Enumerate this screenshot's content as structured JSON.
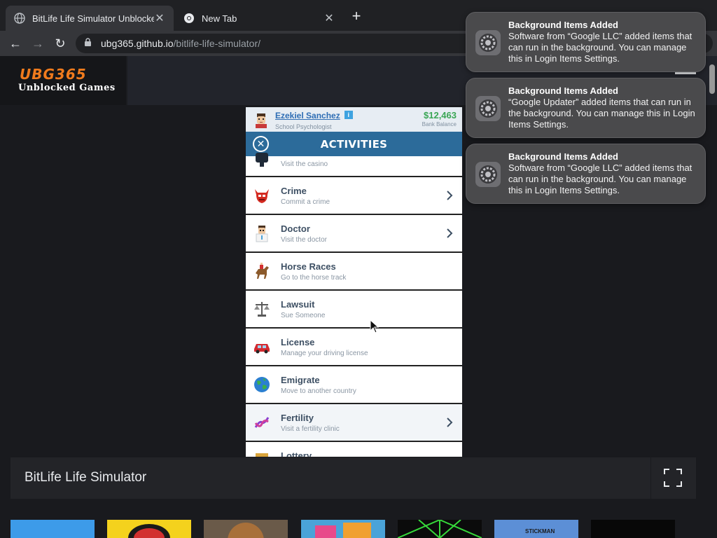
{
  "browser": {
    "tabs": [
      {
        "title": "BitLife Life Simulator Unblocke",
        "active": true
      },
      {
        "title": "New Tab",
        "active": false
      }
    ],
    "new_tab_label": "+",
    "address": {
      "host": "ubg365.github.io",
      "path": "/bitlife-life-simulator/"
    }
  },
  "site": {
    "logo_main": "UBG365",
    "logo_sub": "Unblocked Games"
  },
  "game": {
    "player_name": "Ezekiel Sanchez",
    "info_label": "i",
    "player_job": "School Psychologist",
    "balance": "$12,463",
    "balance_label": "Bank Balance",
    "panel_title": "ACTIVITIES",
    "activities": [
      {
        "name": "",
        "sub": "Visit the casino",
        "icon": "casino-icon"
      },
      {
        "name": "Crime",
        "sub": "Commit a crime",
        "icon": "devil-mask-icon",
        "chevron": true
      },
      {
        "name": "Doctor",
        "sub": "Visit the doctor",
        "icon": "doctor-icon",
        "chevron": true
      },
      {
        "name": "Horse Races",
        "sub": "Go to the horse track",
        "icon": "horse-racing-icon"
      },
      {
        "name": "Lawsuit",
        "sub": "Sue Someone",
        "icon": "scales-icon"
      },
      {
        "name": "License",
        "sub": "Manage your driving license",
        "icon": "car-icon"
      },
      {
        "name": "Emigrate",
        "sub": "Move to another country",
        "icon": "globe-icon"
      },
      {
        "name": "Fertility",
        "sub": "Visit a fertility clinic",
        "icon": "dna-icon",
        "chevron": true
      },
      {
        "name": "Lottery",
        "sub": "",
        "icon": "lottery-icon"
      }
    ]
  },
  "page": {
    "game_title": "BitLife Life Simulator"
  },
  "thumbnails": [
    {
      "color": "#3d9be9"
    },
    {
      "color": "#f4d21d"
    },
    {
      "color": "#6a5a49"
    },
    {
      "color": "#4aa3d8"
    },
    {
      "color": "#0b0b0b"
    },
    {
      "color": "#5c8fd6",
      "label": "STICKMAN"
    },
    {
      "color": "#080808"
    }
  ],
  "notifications": [
    {
      "title": "Background Items Added",
      "body": "Software from “Google LLC” added items that can run in the background. You can manage this in Login Items Settings."
    },
    {
      "title": "Background Items Added",
      "body": "“Google Updater” added items that can run in the background. You can manage this in Login Items Settings."
    },
    {
      "title": "Background Items Added",
      "body": "Software from “Google LLC” added items that can run in the background. You can manage this in Login Items Settings."
    }
  ]
}
